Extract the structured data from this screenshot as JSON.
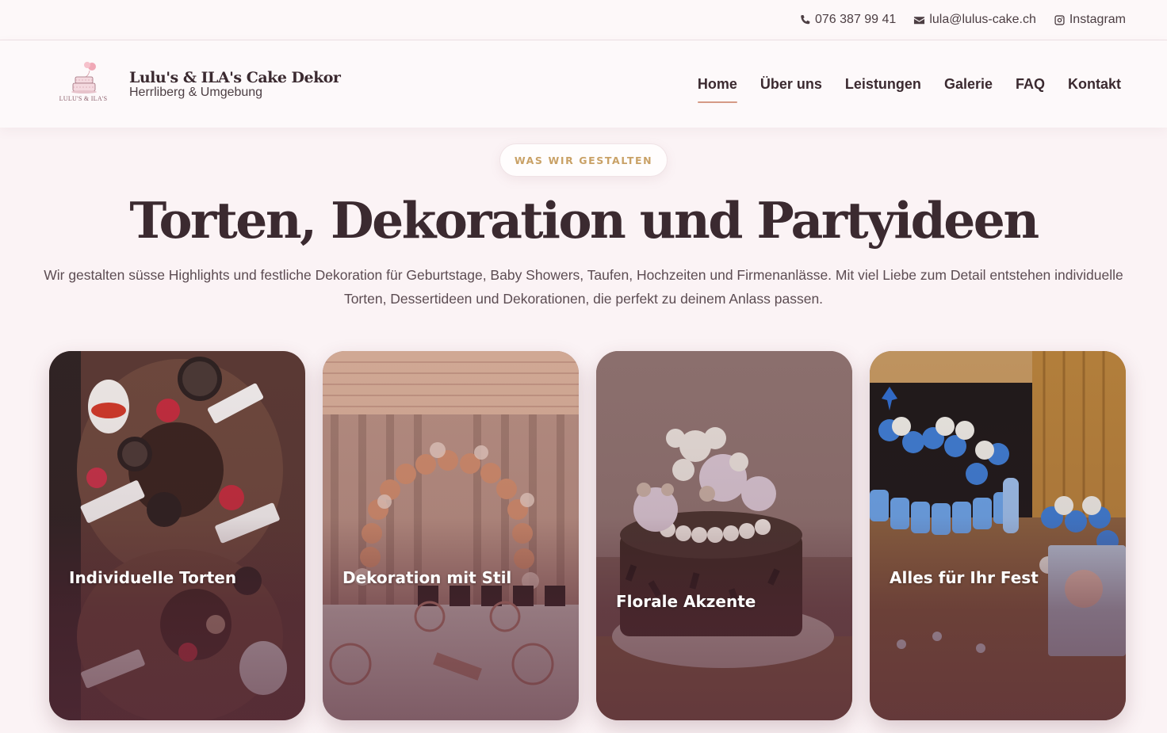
{
  "topbar": {
    "phone": "076 387 99 41",
    "email": "lula@lulus-cake.ch",
    "social": "Instagram"
  },
  "header": {
    "logo_text": "LULU'S & ILA'S",
    "brand_name": "Lulu's & ILA's Cake Dekor",
    "brand_sub": "Herrliberg & Umgebung",
    "nav": [
      {
        "label": "Home",
        "active": true
      },
      {
        "label": "Über uns"
      },
      {
        "label": "Leistungen"
      },
      {
        "label": "Galerie"
      },
      {
        "label": "FAQ"
      },
      {
        "label": "Kontakt"
      }
    ]
  },
  "hero": {
    "eyebrow": "WAS WIR GESTALTEN",
    "title": "Torten, Dekoration und Partyideen",
    "text": "Wir gestalten süsse Highlights und festliche Dekoration für Geburtstage, Baby Showers, Taufen, Hochzeiten und Firmenanlässe. Mit viel Liebe zum Detail entstehen individuelle Torten, Dessertideen und Dekorationen, die perfekt zu deinem Anlass passen."
  },
  "cards": [
    {
      "title": "Individuelle Torten"
    },
    {
      "title": "Dekoration mit Stil"
    },
    {
      "title": "Florale Akzente"
    },
    {
      "title": "Alles für Ihr Fest"
    }
  ],
  "colors": {
    "accent_gold": "#c9a166",
    "nav_underline": "#d59a86",
    "text_dark": "#3b2a30",
    "page_bg": "#fbf3f5"
  }
}
